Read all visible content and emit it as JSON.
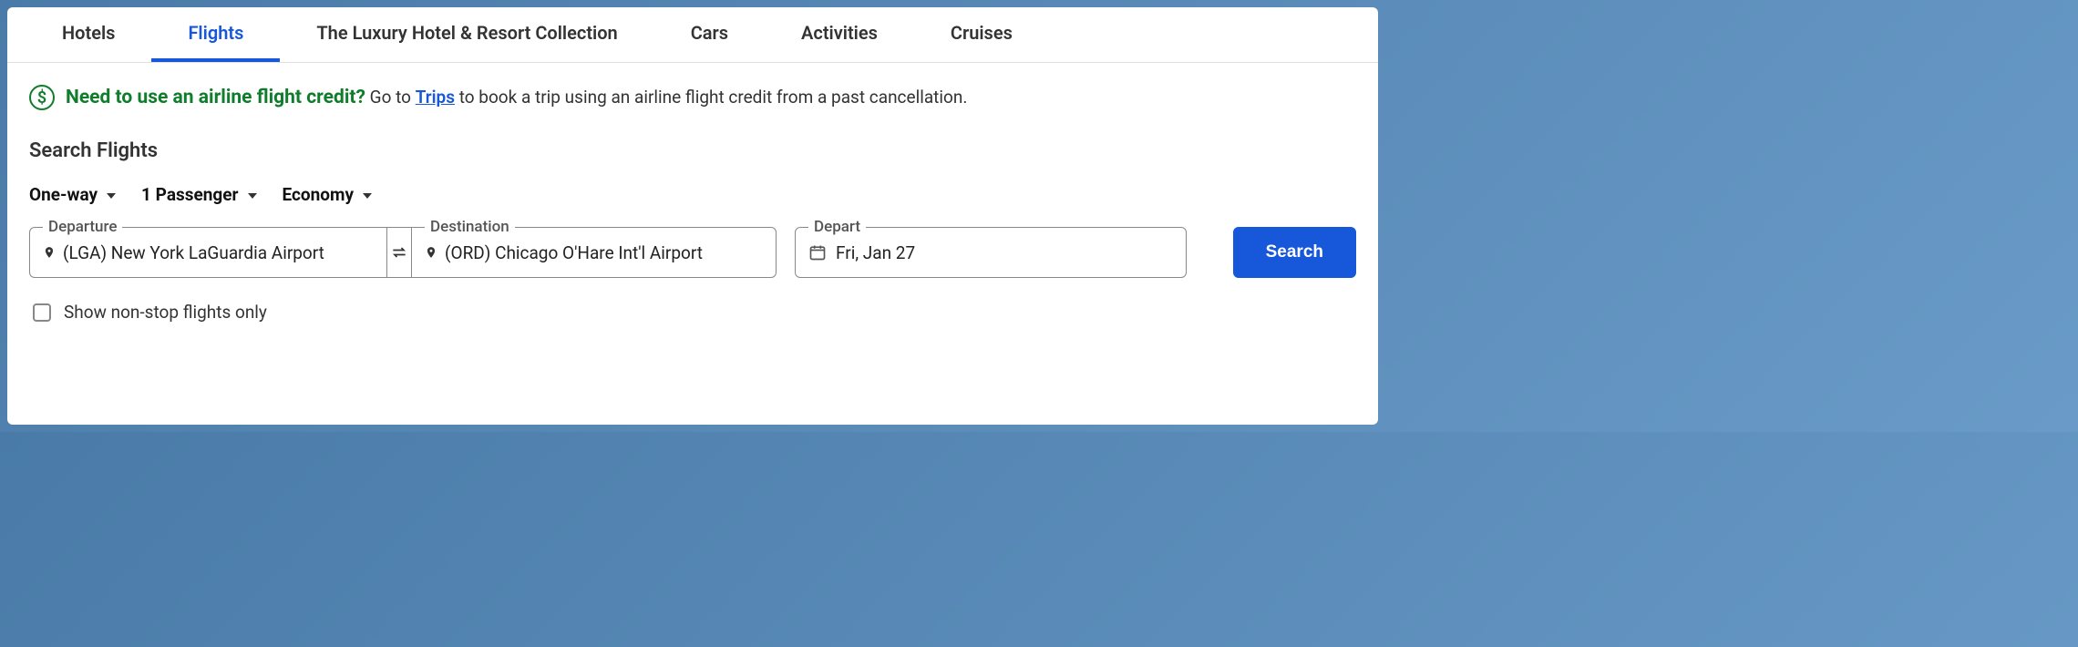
{
  "tabs": {
    "hotels": "Hotels",
    "flights": "Flights",
    "luxury": "The Luxury Hotel & Resort Collection",
    "cars": "Cars",
    "activities": "Activities",
    "cruises": "Cruises"
  },
  "notice": {
    "headline": "Need to use an airline flight credit?",
    "prefix": " Go to ",
    "link_text": "Trips",
    "suffix": " to book a trip using an airline flight credit from a past cancellation."
  },
  "section_title": "Search Flights",
  "options": {
    "trip_type": "One-way",
    "passengers": "1 Passenger",
    "cabin": "Economy"
  },
  "fields": {
    "departure_label": "Departure",
    "departure_value": "(LGA) New York LaGuardia  Airport",
    "destination_label": "Destination",
    "destination_value": "(ORD) Chicago O'Hare Int'l  Airport",
    "depart_label": "Depart",
    "depart_value": "Fri, Jan 27"
  },
  "search_button": "Search",
  "nonstop_label": "Show non-stop flights only",
  "icons": {
    "dollar": "$"
  }
}
